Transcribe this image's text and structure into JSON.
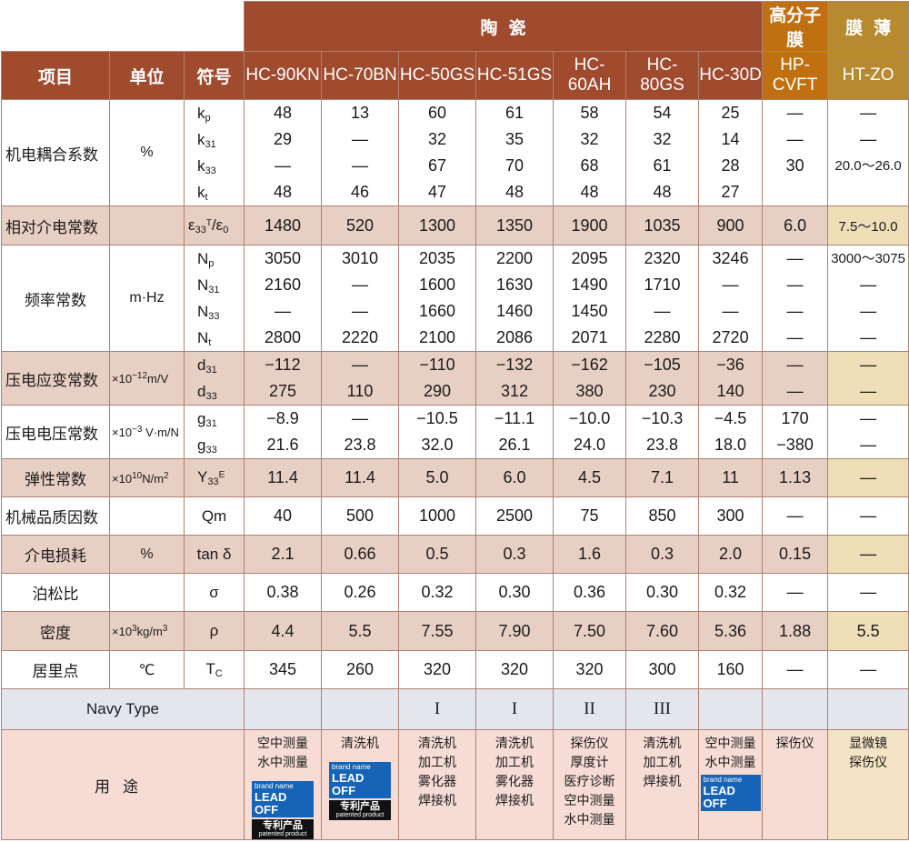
{
  "groups": {
    "ceramics": "陶瓷",
    "polymer": "高分子膜",
    "thinfilm": "膜薄"
  },
  "headers": {
    "item": "项目",
    "unit": "单位",
    "symbol": "符号",
    "models": [
      "HC-90KN",
      "HC-70BN",
      "HC-50GS",
      "HC-51GS",
      "HC-60AH",
      "HC-80GS",
      "HC-30D",
      "HP-CVFT",
      "HT-ZO"
    ]
  },
  "rows": {
    "coupling": {
      "name": "机电耦合系数",
      "unit": "%",
      "symbols": [
        "k",
        "k",
        "k",
        "k"
      ],
      "symbol_subs": [
        "p",
        "31",
        "33",
        "t"
      ],
      "values": [
        [
          "48",
          "29",
          "—",
          "48"
        ],
        [
          "13",
          "—",
          "—",
          "46"
        ],
        [
          "60",
          "32",
          "67",
          "47"
        ],
        [
          "61",
          "35",
          "70",
          "48"
        ],
        [
          "58",
          "32",
          "68",
          "48"
        ],
        [
          "54",
          "32",
          "61",
          "48"
        ],
        [
          "25",
          "14",
          "28",
          "27"
        ],
        [
          "—",
          "—",
          "30",
          ""
        ],
        [
          "—",
          "—",
          "20.0～26.0",
          ""
        ]
      ]
    },
    "dielectric": {
      "name": "相对介电常数",
      "symbol_a": "ε",
      "symbol_a_sub": "33",
      "symbol_a_sup": "T",
      "symbol_slash": "/ε",
      "symbol_b_sub": "0",
      "values": [
        "1480",
        "520",
        "1300",
        "1350",
        "1900",
        "1035",
        "900",
        "6.0",
        "7.5～10.0"
      ]
    },
    "frequency": {
      "name": "频率常数",
      "unit": "m·Hz",
      "symbols": [
        "N",
        "N",
        "N",
        "N"
      ],
      "symbol_subs": [
        "p",
        "31",
        "33",
        "t"
      ],
      "values": [
        [
          "3050",
          "2160",
          "—",
          "2800"
        ],
        [
          "3010",
          "—",
          "—",
          "2220"
        ],
        [
          "2035",
          "1600",
          "1660",
          "2100"
        ],
        [
          "2200",
          "1630",
          "1460",
          "2086"
        ],
        [
          "2095",
          "1490",
          "1450",
          "2071"
        ],
        [
          "2320",
          "1710",
          "—",
          "2280"
        ],
        [
          "3246",
          "—",
          "—",
          "2720"
        ],
        [
          "—",
          "—",
          "—",
          "—"
        ],
        [
          "3000～3075",
          "—",
          "—",
          "—"
        ]
      ]
    },
    "strain": {
      "name": "压电应变常数",
      "unit_a": "×10",
      "unit_exp": "−12",
      "unit_b": "m/V",
      "symbols": [
        "d",
        "d"
      ],
      "symbol_subs": [
        "31",
        "33"
      ],
      "values": [
        [
          "−112",
          "275"
        ],
        [
          "—",
          "110"
        ],
        [
          "−110",
          "290"
        ],
        [
          "−132",
          "312"
        ],
        [
          "−162",
          "380"
        ],
        [
          "−105",
          "230"
        ],
        [
          "−36",
          "140"
        ],
        [
          "—",
          "—"
        ],
        [
          "—",
          "—"
        ]
      ]
    },
    "voltage": {
      "name": "压电电压常数",
      "unit_a": "×10",
      "unit_exp": "−3",
      "unit_b": " V·m/N",
      "symbols": [
        "g",
        "g"
      ],
      "symbol_subs": [
        "31",
        "33"
      ],
      "values": [
        [
          "−8.9",
          "21.6"
        ],
        [
          "—",
          "23.8"
        ],
        [
          "−10.5",
          "32.0"
        ],
        [
          "−11.1",
          "26.1"
        ],
        [
          "−10.0",
          "24.0"
        ],
        [
          "−10.3",
          "23.8"
        ],
        [
          "−4.5",
          "18.0"
        ],
        [
          "170",
          "−380"
        ],
        [
          "—",
          "—"
        ]
      ]
    },
    "elastic": {
      "name": "弹性常数",
      "unit_a": "×10",
      "unit_exp": "10",
      "unit_b": "N/m",
      "unit_sup2": "2",
      "symbol": "Y",
      "symbol_sub": "33",
      "symbol_sup": "E",
      "values": [
        "11.4",
        "11.4",
        "5.0",
        "6.0",
        "4.5",
        "7.1",
        "11",
        "1.13",
        "—"
      ]
    },
    "qm": {
      "name": "机械品质因数",
      "symbol": "Qm",
      "values": [
        "40",
        "500",
        "1000",
        "2500",
        "75",
        "850",
        "300",
        "—",
        "—"
      ]
    },
    "loss": {
      "name": "介电损耗",
      "unit": "%",
      "symbol": "tan δ",
      "values": [
        "2.1",
        "0.66",
        "0.5",
        "0.3",
        "1.6",
        "0.3",
        "2.0",
        "0.15",
        "—"
      ]
    },
    "poisson": {
      "name": "泊松比",
      "symbol": "σ",
      "values": [
        "0.38",
        "0.26",
        "0.32",
        "0.30",
        "0.36",
        "0.30",
        "0.32",
        "—",
        "—"
      ]
    },
    "density": {
      "name": "密度",
      "unit_a": "×10",
      "unit_exp": "3",
      "unit_b": "kg/m",
      "unit_sup2": "3",
      "symbol": "ρ",
      "values": [
        "4.4",
        "5.5",
        "7.55",
        "7.90",
        "7.50",
        "7.60",
        "5.36",
        "1.88",
        "5.5"
      ]
    },
    "curie": {
      "name": "居里点",
      "unit": "℃",
      "symbol": "T",
      "symbol_sub": "C",
      "values": [
        "345",
        "260",
        "320",
        "320",
        "320",
        "300",
        "160",
        "—",
        "—"
      ]
    },
    "navy": {
      "name": "Navy Type",
      "values": [
        "",
        "",
        "I",
        "I",
        "II",
        "III",
        "",
        "",
        ""
      ]
    },
    "use": {
      "name": "用途",
      "values": [
        [
          "空中测量",
          "水中测量"
        ],
        [
          "清洗机"
        ],
        [
          "清洗机",
          "加工机",
          "雾化器",
          "焊接机"
        ],
        [
          "清洗机",
          "加工机",
          "雾化器",
          "焊接机"
        ],
        [
          "探伤仪",
          "厚度计",
          "医疗诊断",
          "空中测量",
          "水中测量"
        ],
        [
          "清洗机",
          "加工机",
          "焊接机"
        ],
        [
          "空中测量",
          "水中测量"
        ],
        [
          "探伤仪"
        ],
        [
          "显微镜",
          "探伤仪"
        ]
      ],
      "badge": {
        "small": "brand name",
        "large": "LEAD OFF",
        "patent": "专利产品",
        "patent_en": "patented product"
      }
    }
  },
  "colors": {
    "header_red": "#a04a2e",
    "header_orange": "#c07010",
    "header_gold": "#b88a30",
    "pink_band": "#e8cfc4",
    "tan_band": "#eedfb8"
  }
}
